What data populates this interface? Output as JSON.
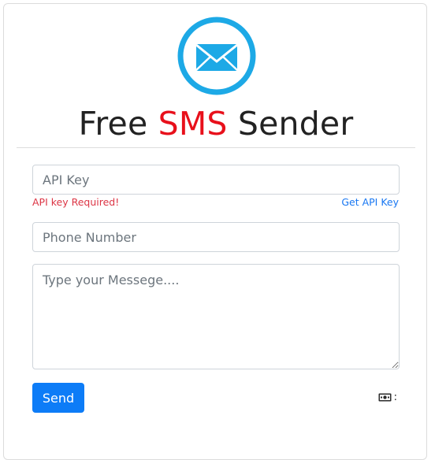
{
  "header": {
    "title_part1": "Free",
    "title_highlight": "SMS",
    "title_part2": "Sender",
    "logo_icon": "envelope-icon",
    "logo_color": "#1da9e6",
    "highlight_color": "#e8101b"
  },
  "form": {
    "api_key": {
      "value": "",
      "placeholder": "API Key"
    },
    "api_key_error": "API key Required!",
    "get_api_key_link": "Get API Key",
    "phone": {
      "value": "",
      "placeholder": "Phone Number"
    },
    "message": {
      "value": "",
      "placeholder": "Type your Messege...."
    },
    "send_label": "Send",
    "send_color": "#0d7cf7"
  },
  "balance": {
    "icon": "money-icon",
    "separator": ":",
    "value": ""
  }
}
